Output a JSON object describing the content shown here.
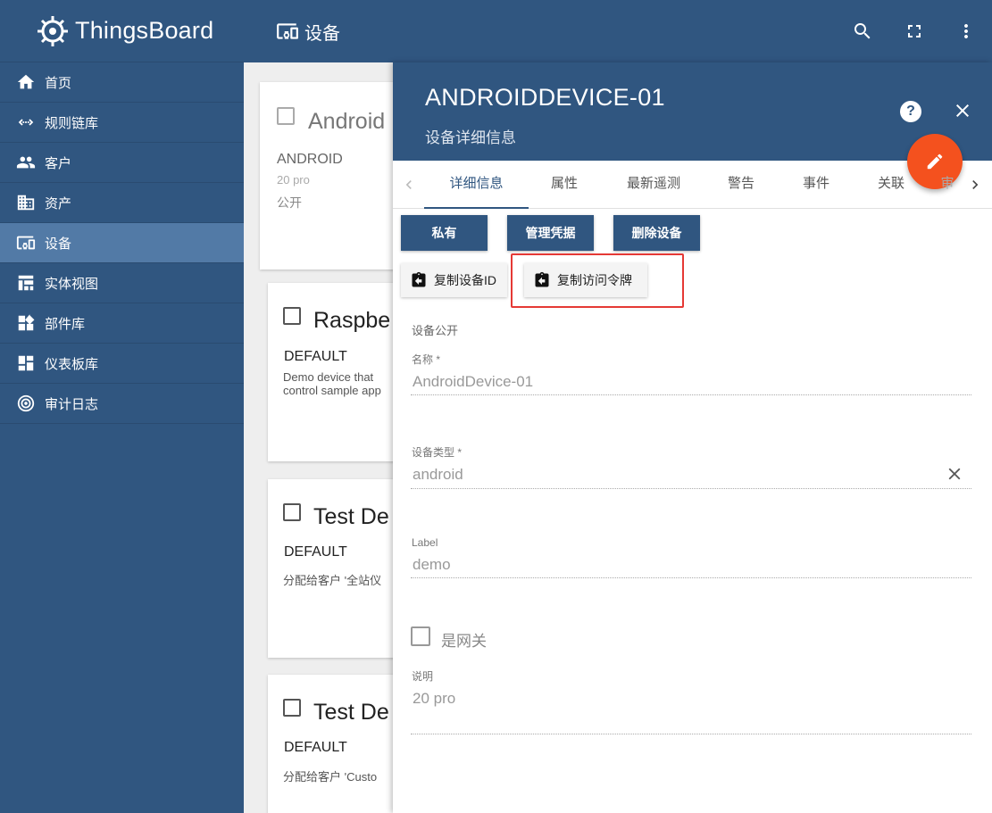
{
  "app": {
    "title": "ThingsBoard"
  },
  "sidebar": {
    "items": [
      {
        "label": "首页",
        "icon": "home-icon"
      },
      {
        "label": "规则链库",
        "icon": "rule-chain-icon"
      },
      {
        "label": "客户",
        "icon": "customers-icon"
      },
      {
        "label": "资产",
        "icon": "assets-icon"
      },
      {
        "label": "设备",
        "icon": "devices-icon",
        "active": true
      },
      {
        "label": "实体视图",
        "icon": "entity-view-icon"
      },
      {
        "label": "部件库",
        "icon": "widgets-icon"
      },
      {
        "label": "仪表板库",
        "icon": "dashboards-icon"
      },
      {
        "label": "审计日志",
        "icon": "audit-log-icon"
      }
    ]
  },
  "topbar": {
    "title": "设备",
    "icons": [
      "search-icon",
      "fullscreen-icon",
      "more-vert-icon"
    ]
  },
  "cards": [
    {
      "title": "Android",
      "type": "ANDROID",
      "desc": "20 pro",
      "extra": "公开"
    },
    {
      "title": "Raspbe",
      "type": "DEFAULT",
      "desc": "Demo device that\ncontrol sample app"
    },
    {
      "title": "Test De",
      "type": "DEFAULT",
      "desc": "分配给客户 '全站仪"
    },
    {
      "title": "Test De",
      "type": "DEFAULT",
      "desc": "分配给客户 'Custo"
    }
  ],
  "detail": {
    "title": "ANDROIDDEVICE-01",
    "subtitle": "设备详细信息",
    "help": "?",
    "tabs": [
      "详细信息",
      "属性",
      "最新遥测",
      "警告",
      "事件",
      "关联",
      "审"
    ],
    "active_tab": 0,
    "buttons": {
      "private": "私有",
      "credentials": "管理凭据",
      "delete": "删除设备"
    },
    "copy_buttons": {
      "copy_id": "复制设备ID",
      "copy_token": "复制访问令牌"
    },
    "public_label": "设备公开",
    "fields": {
      "name_label": "名称 *",
      "name_value": "AndroidDevice-01",
      "type_label": "设备类型 *",
      "type_value": "android",
      "label_label": "Label",
      "label_value": "demo",
      "gateway_label": "是网关",
      "desc_label": "说明",
      "desc_value": "20 pro"
    }
  },
  "colors": {
    "primary": "#305680",
    "sidebar_active": "#527aa6",
    "accent": "#f4511e",
    "highlight": "#e53935"
  }
}
